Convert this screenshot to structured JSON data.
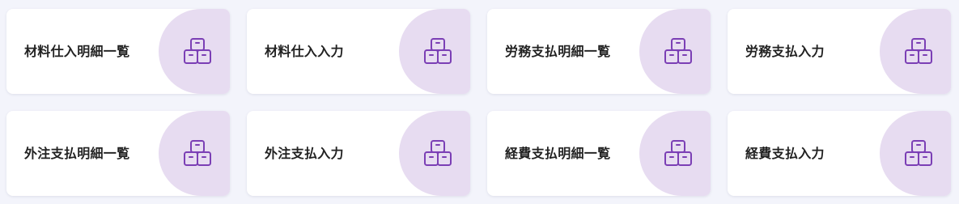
{
  "accent_color": "#7b3fb5",
  "bubble_color": "#e7dcf1",
  "cards": [
    {
      "label": "材料仕入明細一覧",
      "icon": "boxes-icon"
    },
    {
      "label": "材料仕入入力",
      "icon": "boxes-icon"
    },
    {
      "label": "労務支払明細一覧",
      "icon": "boxes-icon"
    },
    {
      "label": "労務支払入力",
      "icon": "boxes-icon"
    },
    {
      "label": "外注支払明細一覧",
      "icon": "boxes-icon"
    },
    {
      "label": "外注支払入力",
      "icon": "boxes-icon"
    },
    {
      "label": "経費支払明細一覧",
      "icon": "boxes-icon"
    },
    {
      "label": "経費支払入力",
      "icon": "boxes-icon"
    }
  ]
}
